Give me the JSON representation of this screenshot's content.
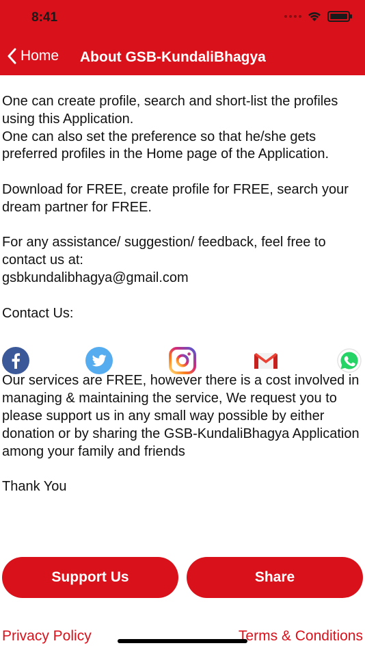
{
  "status_bar": {
    "time": "8:41"
  },
  "nav": {
    "back_label": "Home",
    "title": "About GSB-KundaliBhagya"
  },
  "content": {
    "intro": "One can create profile, search and short-list the profiles using this Application.\nOne can also set the preference so that he/she gets preferred profiles in the Home page of the Application.",
    "free": "Download for FREE, create profile for FREE, search your dream partner for FREE.",
    "assistance": "For any assistance/ suggestion/ feedback, feel free to contact us at:\ngsbkundalibhagya@gmail.com",
    "contact_label": "Contact Us:",
    "services": "Our services are FREE, however there is a cost involved in managing & maintaining the service, We request you to please support us in any small way possible by either donation or by sharing the GSB-KundaliBhagya Application among your family and friends",
    "thanks": "Thank You"
  },
  "social": [
    {
      "icon": "facebook-icon",
      "color": "#3b5998"
    },
    {
      "icon": "twitter-icon",
      "color": "#55acee"
    },
    {
      "icon": "instagram-icon",
      "color": "#c13584"
    },
    {
      "icon": "gmail-icon",
      "color": "#ea4335"
    },
    {
      "icon": "whatsapp-icon",
      "color": "#25d366"
    }
  ],
  "buttons": {
    "support": "Support Us",
    "share": "Share"
  },
  "links": {
    "privacy": "Privacy Policy",
    "terms": "Terms & Conditions"
  },
  "colors": {
    "brand": "#d9111b",
    "text": "#111111"
  }
}
